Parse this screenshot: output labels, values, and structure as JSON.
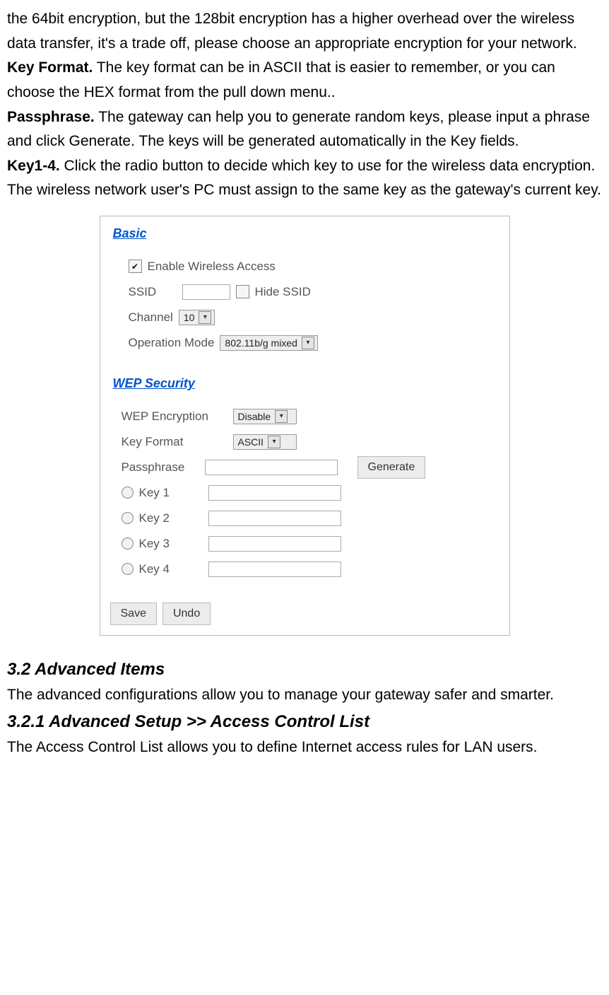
{
  "intro": {
    "p1": "the 64bit encryption, but the 128bit encryption has a higher overhead over the wireless data transfer, it's a trade off, please choose an appropriate encryption for your network.",
    "keyformat_label": "Key Format.",
    "keyformat_text": " The key format can be in ASCII that is easier to remember, or you can choose the HEX format from the pull down menu..",
    "passphrase_label": "Passphrase.",
    "passphrase_text": " The gateway can help you to generate random keys, please input a phrase and click Generate. The keys will be generated automatically in the Key fields.",
    "key14_label": "Key1-4.",
    "key14_text": " Click the radio button to decide which key to use for the wireless data encryption. The wireless network user's PC must assign to the same key as the gateway's current key."
  },
  "panel": {
    "basic": {
      "title": "Basic",
      "enable_label": "Enable Wireless Access",
      "enable_checked": true,
      "ssid_label": "SSID",
      "ssid_value": "",
      "hide_ssid_label": "Hide SSID",
      "hide_ssid_checked": false,
      "channel_label": "Channel",
      "channel_value": "10",
      "opmode_label": "Operation Mode",
      "opmode_value": "802.11b/g mixed"
    },
    "wep": {
      "title": "WEP Security",
      "encryption_label": "WEP Encryption",
      "encryption_value": "Disable",
      "keyformat_label": "Key Format",
      "keyformat_value": "ASCII",
      "passphrase_label": "Passphrase",
      "passphrase_value": "",
      "generate_label": "Generate",
      "keys": [
        {
          "label": "Key 1",
          "value": ""
        },
        {
          "label": "Key 2",
          "value": ""
        },
        {
          "label": "Key 3",
          "value": ""
        },
        {
          "label": "Key 4",
          "value": ""
        }
      ],
      "save_label": "Save",
      "undo_label": "Undo"
    }
  },
  "adv": {
    "h1": "3.2 Advanced Items",
    "p1": "The advanced configurations allow you to manage your gateway safer and smarter.",
    "h2": "3.2.1 Advanced Setup >> Access Control List",
    "p2": "The Access Control List allows you to define Internet access rules for LAN users."
  }
}
